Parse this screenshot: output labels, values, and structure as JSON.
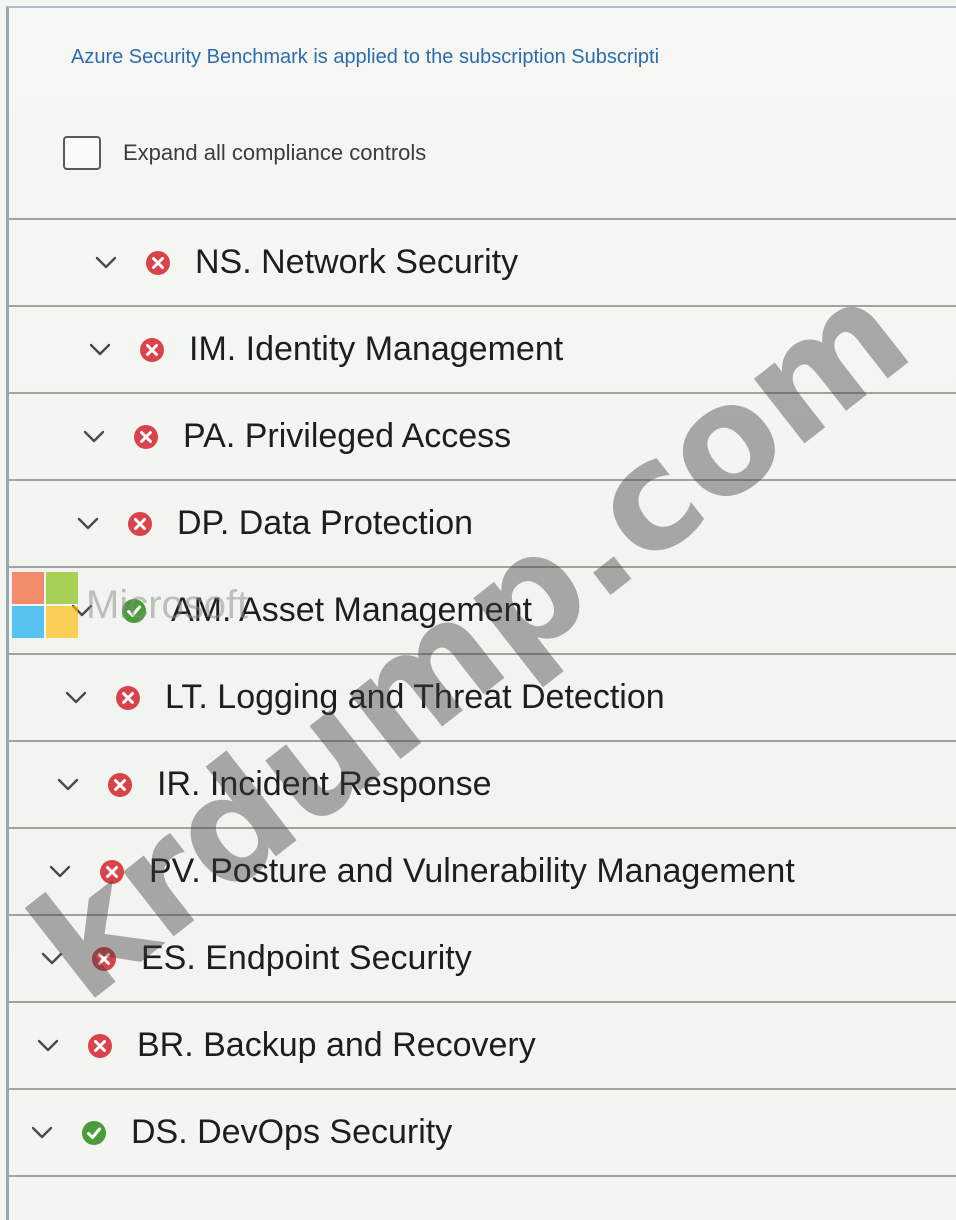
{
  "intro_text": "Azure Security Benchmark is applied to the subscription Subscripti",
  "expand_label": "Expand all compliance controls",
  "colors": {
    "failed": "#d9434b",
    "passed": "#4a9b3a",
    "link_text": "#2b6cb0"
  },
  "controls": [
    {
      "label": "NS. Network Security",
      "status": "failed",
      "status_icon": "failed-icon"
    },
    {
      "label": "IM. Identity Management",
      "status": "failed",
      "status_icon": "failed-icon"
    },
    {
      "label": "PA. Privileged Access",
      "status": "failed",
      "status_icon": "failed-icon"
    },
    {
      "label": "DP. Data Protection",
      "status": "failed",
      "status_icon": "failed-icon"
    },
    {
      "label": "AM. Asset Management",
      "status": "passed",
      "status_icon": "passed-icon"
    },
    {
      "label": "LT. Logging and Threat Detection",
      "status": "failed",
      "status_icon": "failed-icon"
    },
    {
      "label": "IR. Incident Response",
      "status": "failed",
      "status_icon": "failed-icon"
    },
    {
      "label": "PV. Posture and Vulnerability Management",
      "status": "failed",
      "status_icon": "failed-icon"
    },
    {
      "label": "ES. Endpoint Security",
      "status": "failed",
      "status_icon": "failed-icon"
    },
    {
      "label": "BR. Backup and Recovery",
      "status": "failed",
      "status_icon": "failed-icon"
    },
    {
      "label": "DS. DevOps Security",
      "status": "passed",
      "status_icon": "passed-icon"
    }
  ],
  "overlay_logo_text": "Microsoft",
  "watermark_text": "krdump.com"
}
